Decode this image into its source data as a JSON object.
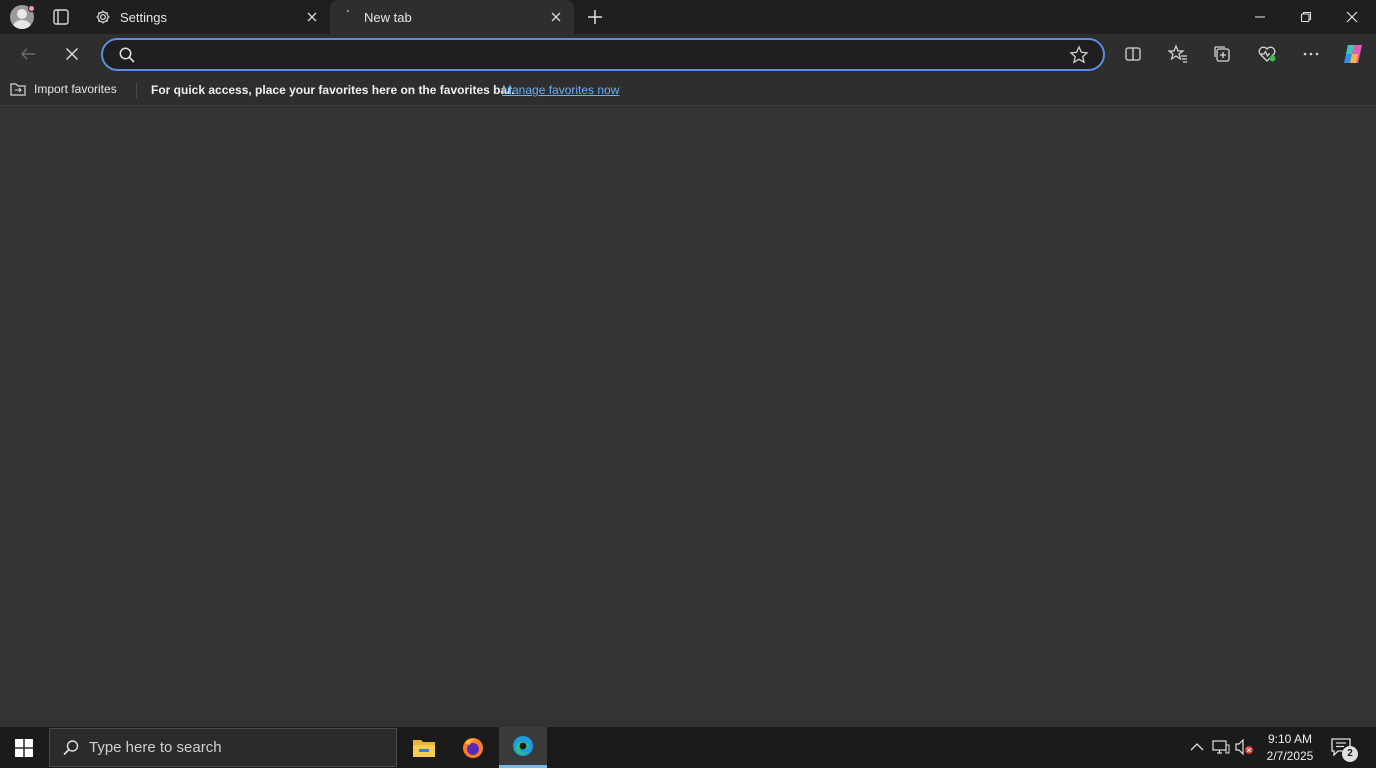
{
  "browser": {
    "tabs": [
      {
        "label": "Settings",
        "icon": "gear-icon",
        "active": false
      },
      {
        "label": "New tab",
        "icon": "loading-icon",
        "active": true
      }
    ],
    "address_bar": {
      "value": "",
      "placeholder": ""
    },
    "favorites_bar": {
      "import_label": "Import favorites",
      "message": "For quick access, place your favorites here on the favorites bar.",
      "link_label": "Manage favorites now"
    }
  },
  "taskbar": {
    "search_placeholder": "Type here to search",
    "apps": [
      "file-explorer-icon",
      "firefox-icon",
      "edge-icon"
    ],
    "clock": {
      "time": "9:10 AM",
      "date": "2/7/2025"
    },
    "notification_count": "2"
  },
  "colors": {
    "accent": "#5a8fe0",
    "link": "#6ab0f5",
    "content_bg": "#333333",
    "taskbar_bg": "#1b1b1b"
  }
}
